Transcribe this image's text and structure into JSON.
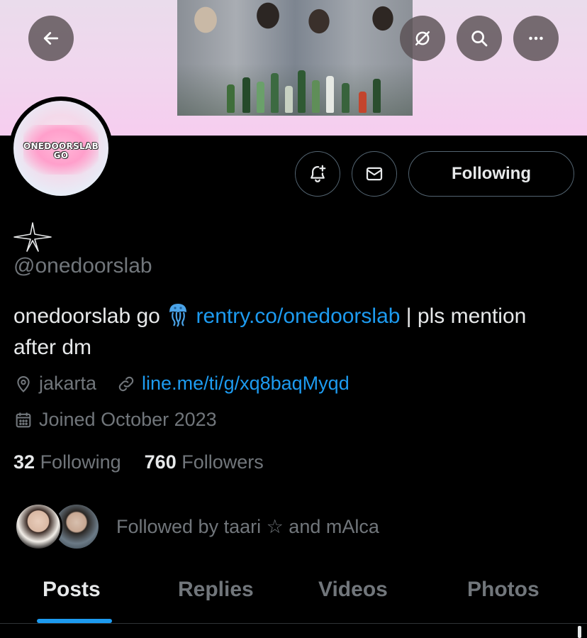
{
  "profile": {
    "display_name_icon": "four-pointed-star-icon",
    "handle": "@onedoorslab",
    "avatar_logo_line1": "ONEDOORSLAB",
    "avatar_logo_line2": "GO",
    "bio_text1": "onedoorslab go ",
    "bio_emoji": "jellyfish-icon",
    "bio_link": "rentry.co/onedoorslab",
    "bio_text2": " | pls mention after dm",
    "location": "jakarta",
    "website": "line.me/ti/g/xq8baqMyqd",
    "joined": "Joined October 2023",
    "following_count": "32",
    "following_label": "Following",
    "followers_count": "760",
    "followers_label": "Followers",
    "followed_by": "Followed by taari ☆ and mAlca"
  },
  "header": {
    "back_icon": "arrow-left-icon",
    "grok_icon": "slashed-circle-icon",
    "search_icon": "search-icon",
    "more_icon": "more-dots-icon"
  },
  "actions": {
    "notify_icon": "bell-plus-icon",
    "message_icon": "envelope-icon",
    "follow_label": "Following"
  },
  "tabs": [
    {
      "label": "Posts",
      "active": true
    },
    {
      "label": "Replies",
      "active": false
    },
    {
      "label": "Videos",
      "active": false
    },
    {
      "label": "Photos",
      "active": false
    }
  ],
  "colors": {
    "accent": "#1d9bf0",
    "background": "#000000",
    "muted_text": "#71767b",
    "primary_text": "#e7e9ea",
    "border": "#536471"
  }
}
